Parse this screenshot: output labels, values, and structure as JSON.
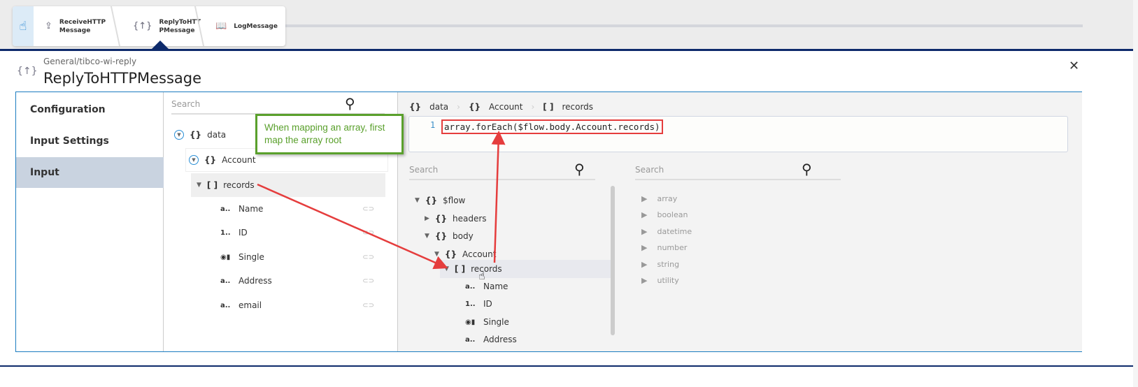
{
  "flow": {
    "steps": [
      {
        "icon": "receive-icon",
        "label": "ReceiveHTTP\nMessage"
      },
      {
        "icon": "reply-icon",
        "label": "ReplyToHTT\nPMessage"
      },
      {
        "icon": "log-icon",
        "label": "LogMessage"
      }
    ]
  },
  "header": {
    "path": "General/tibco-wi-reply",
    "title": "ReplyToHTTPMessage"
  },
  "nav": {
    "items": [
      {
        "label": "Configuration"
      },
      {
        "label": "Input Settings"
      },
      {
        "label": "Input",
        "selected": true
      }
    ]
  },
  "schema": {
    "search_placeholder": "Search",
    "data": "data",
    "account": "Account",
    "records": "records",
    "fields": [
      {
        "type": "a..",
        "name": "Name"
      },
      {
        "type": "1..",
        "name": "ID"
      },
      {
        "type": "toggle",
        "name": "Single"
      },
      {
        "type": "a..",
        "name": "Address"
      },
      {
        "type": "a..",
        "name": "email"
      }
    ]
  },
  "breadcrumb": [
    "data",
    "Account",
    "records"
  ],
  "editor": {
    "line": "1",
    "code": "array.forEach($flow.body.Account.records)"
  },
  "flowtree": {
    "search_placeholder": "Search",
    "root": "$flow",
    "headers": "headers",
    "body": "body",
    "account": "Account",
    "records": "records",
    "fields": [
      {
        "type": "a..",
        "name": "Name"
      },
      {
        "type": "1..",
        "name": "ID"
      },
      {
        "type": "toggle",
        "name": "Single"
      },
      {
        "type": "a..",
        "name": "Address"
      }
    ]
  },
  "functions": {
    "search_placeholder": "Search",
    "items": [
      "array",
      "boolean",
      "datetime",
      "number",
      "string",
      "utility"
    ]
  },
  "annotation": "When mapping an array, first map the array root",
  "colors": {
    "accent": "#1b7cc0",
    "navy": "#0d2a6b",
    "annotation": "#5aa02c",
    "arrow": "#e53d3d"
  }
}
